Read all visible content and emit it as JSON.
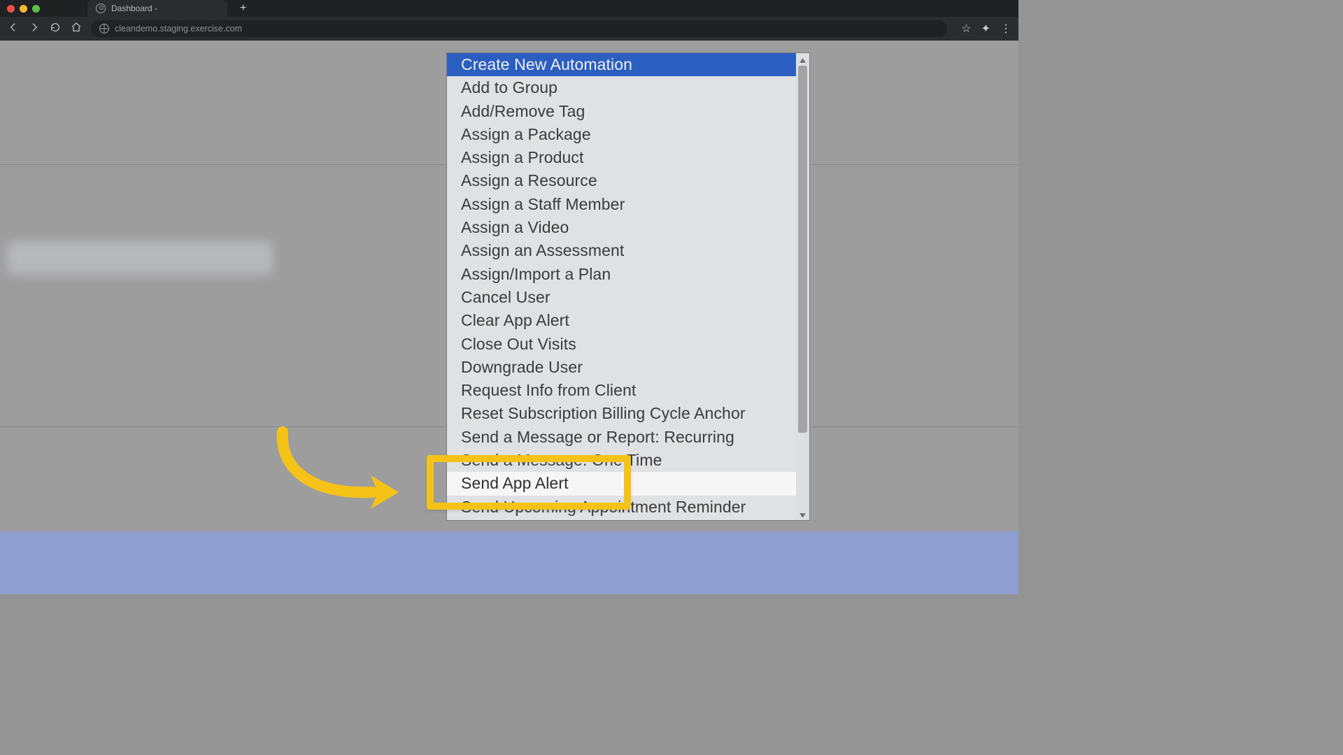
{
  "browser": {
    "tab_title": "Dashboard -",
    "new_tab_glyph": "+",
    "url": "cleandemo.staging.exercise.com",
    "star_glyph": "☆",
    "ext_glyph": "✦",
    "menu_glyph": "⋮"
  },
  "dropdown": {
    "options": [
      "Create New Automation",
      "Add to Group",
      "Add/Remove Tag",
      "Assign a Package",
      "Assign a Product",
      "Assign a Resource",
      "Assign a Staff Member",
      "Assign a Video",
      "Assign an Assessment",
      "Assign/Import a Plan",
      "Cancel User",
      "Clear App Alert",
      "Close Out Visits",
      "Downgrade User",
      "Request Info from Client",
      "Reset Subscription Billing Cycle Anchor",
      "Send a Message or Report: Recurring",
      "Send a Message: One Time",
      "Send App Alert",
      "Send Upcoming Appointment Reminder"
    ],
    "selected_index": 0,
    "hovered_index": 18,
    "highlight_annotation_index": 18
  },
  "colors": {
    "select_highlight": "#2a5fc1",
    "annotation": "#f5c317"
  }
}
